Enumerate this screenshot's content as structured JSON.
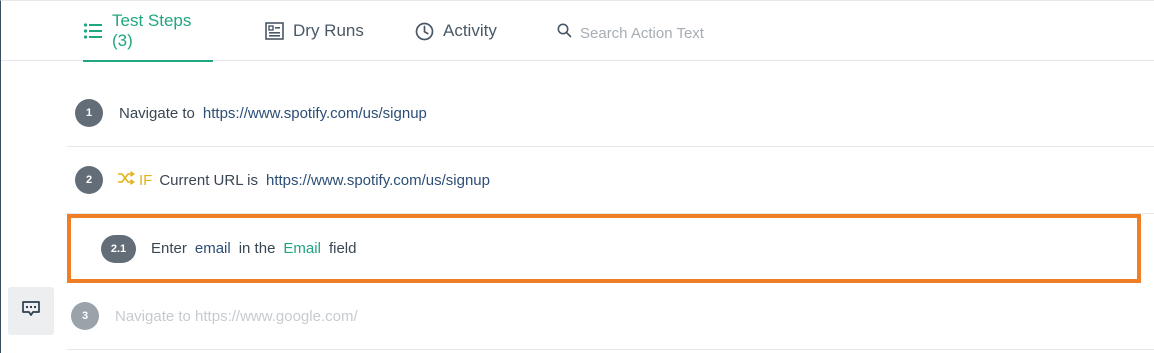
{
  "tabs": [
    {
      "label": "Test Steps (3)",
      "icon": "list-icon",
      "active": true
    },
    {
      "label": "Dry Runs",
      "icon": "document-icon",
      "active": false
    },
    {
      "label": "Activity",
      "icon": "clock-icon",
      "active": false
    }
  ],
  "search": {
    "placeholder": "Search Action Text",
    "value": ""
  },
  "steps": [
    {
      "number": "1",
      "action": "Navigate to",
      "url": "https://www.spotify.com/us/signup"
    },
    {
      "number": "2",
      "if_label": "IF",
      "condition": "Current URL is",
      "url": "https://www.spotify.com/us/signup"
    },
    {
      "number": "2.1",
      "w1": "Enter",
      "value": "email",
      "w2": "in the",
      "field": "Email",
      "w3": "field"
    },
    {
      "number": "3",
      "text": "Navigate to https://www.google.com/"
    }
  ],
  "colors": {
    "accent": "#20a681",
    "highlight": "#f07e26",
    "if": "#e4b21b",
    "badge": "#636d78"
  }
}
